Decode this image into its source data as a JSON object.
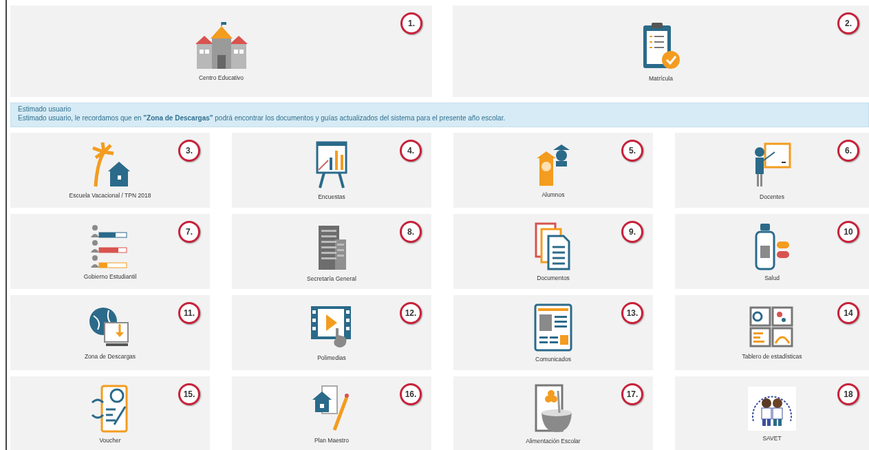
{
  "top_tiles": [
    {
      "label": "Centro Educativo",
      "badge": "1."
    },
    {
      "label": "Matrícula",
      "badge": "2."
    }
  ],
  "alert": {
    "title": "Estimado usuario",
    "message": "Estimado usuario, le recordamos que en **\"Zona de Descargas\"** podrá encontrar los documentos y guías actualizados del sistema para el presente año escolar."
  },
  "tiles": [
    {
      "label": "Escuela Vacacional / TPN 2018",
      "badge": "3."
    },
    {
      "label": "Encuestas",
      "badge": "4."
    },
    {
      "label": "Alumnos",
      "badge": "5."
    },
    {
      "label": "Docentes",
      "badge": "6."
    },
    {
      "label": "Gobierno Estudiantil",
      "badge": "7."
    },
    {
      "label": "Secretaría General",
      "badge": "8."
    },
    {
      "label": "Documentos",
      "badge": "9."
    },
    {
      "label": "Salud",
      "badge": "10"
    },
    {
      "label": "Zona de Descargas",
      "badge": "11."
    },
    {
      "label": "Polimedias",
      "badge": "12."
    },
    {
      "label": "Comunicados",
      "badge": "13."
    },
    {
      "label": "Tablero de estadísticas",
      "badge": "14"
    },
    {
      "label": "Voucher",
      "badge": "15."
    },
    {
      "label": "Plan Maestro",
      "badge": "16."
    },
    {
      "label": "Alimentación Escolar",
      "badge": "17."
    },
    {
      "label": "SAVET",
      "badge": "18"
    }
  ]
}
